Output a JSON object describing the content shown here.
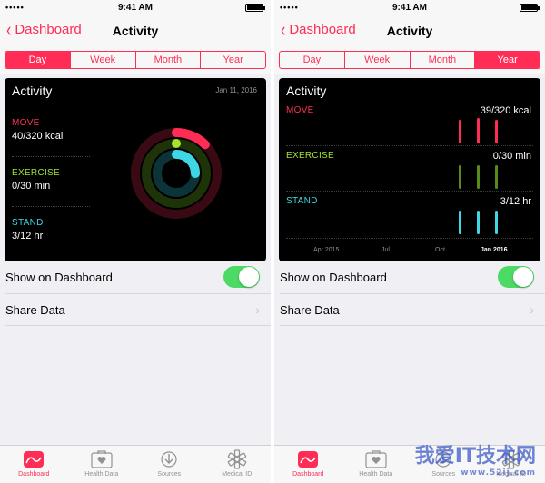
{
  "status": {
    "carrier": "•••••",
    "time": "9:41 AM",
    "battery_level": 1.0
  },
  "nav": {
    "back_label": "Dashboard",
    "title": "Activity"
  },
  "segments": [
    "Day",
    "Week",
    "Month",
    "Year"
  ],
  "left": {
    "active_segment": "Day",
    "card_title": "Activity",
    "date": "Jan 11, 2016",
    "metrics": [
      {
        "label": "MOVE",
        "value": "40/320 kcal",
        "color": "#ff2d55"
      },
      {
        "label": "EXERCISE",
        "value": "0/30 min",
        "color": "#a6e22e"
      },
      {
        "label": "STAND",
        "value": "3/12 hr",
        "color": "#3fd6e6"
      }
    ],
    "rings": [
      {
        "name": "move",
        "fraction": 0.125,
        "color": "#ff2d55"
      },
      {
        "name": "exercise",
        "fraction": 0.0,
        "color": "#a6e22e"
      },
      {
        "name": "stand",
        "fraction": 0.25,
        "color": "#3fd6e6"
      }
    ]
  },
  "right": {
    "active_segment": "Year",
    "card_title": "Activity",
    "metrics": [
      {
        "label": "MOVE",
        "value": "39/320 kcal",
        "color": "#ff2d55"
      },
      {
        "label": "EXERCISE",
        "value": "0/30 min",
        "color": "#a6e22e"
      },
      {
        "label": "STAND",
        "value": "3/12 hr",
        "color": "#3fd6e6"
      }
    ],
    "x_ticks": [
      "Apr 2015",
      "Jul",
      "Oct",
      "Jan 2016"
    ]
  },
  "settings": {
    "show_on_dashboard": "Show on Dashboard",
    "show_on_dashboard_on": true,
    "share_data": "Share Data"
  },
  "tabs": [
    {
      "label": "Dashboard",
      "icon": "dashboard-icon",
      "active": true
    },
    {
      "label": "Health Data",
      "icon": "health-data-icon",
      "active": false
    },
    {
      "label": "Sources",
      "icon": "sources-icon",
      "active": false
    },
    {
      "label": "Medical ID",
      "icon": "medical-id-icon",
      "active": false
    }
  ],
  "watermark": {
    "main": "我爱IT技术网",
    "sub": "www.52ij.com"
  },
  "colors": {
    "accent": "#ff2d55",
    "toggle_on": "#4cd964"
  }
}
